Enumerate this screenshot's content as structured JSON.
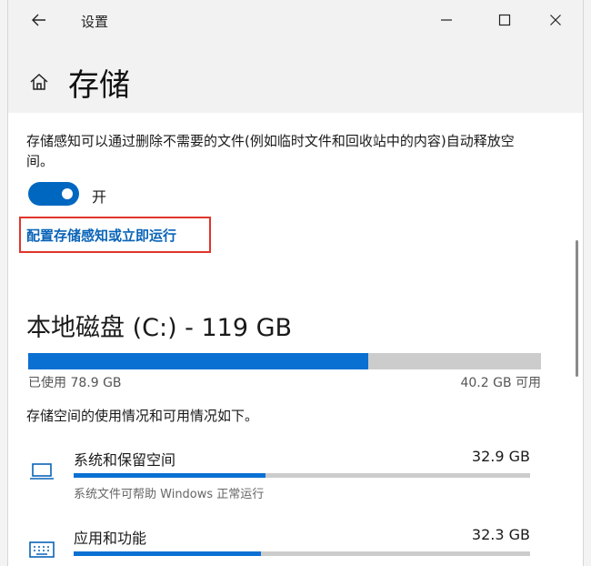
{
  "window": {
    "title": "设置"
  },
  "header": {
    "title": "存储"
  },
  "storage_sense": {
    "description": "存储感知可以通过删除不需要的文件(例如临时文件和回收站中的内容)自动释放空间。",
    "toggle_on": true,
    "toggle_label": "开",
    "configure_link": "配置存储感知或立即运行"
  },
  "drive": {
    "title": "本地磁盘 (C:) - 119 GB",
    "used_fraction": 0.663,
    "used_label": "已使用 78.9 GB",
    "free_label": "40.2 GB 可用",
    "usage_description": "存储空间的使用情况和可用情况如下。"
  },
  "categories": [
    {
      "icon": "laptop-icon",
      "name": "系统和保留空间",
      "size": "32.9 GB",
      "fraction": 0.42,
      "subtitle": "系统文件可帮助 Windows 正常运行"
    },
    {
      "icon": "keyboard-icon",
      "name": "应用和功能",
      "size": "32.3 GB",
      "fraction": 0.41,
      "subtitle": ""
    }
  ],
  "colors": {
    "accent": "#0a70d2",
    "link": "#0a64b8",
    "highlight_box": "#e0352b"
  }
}
